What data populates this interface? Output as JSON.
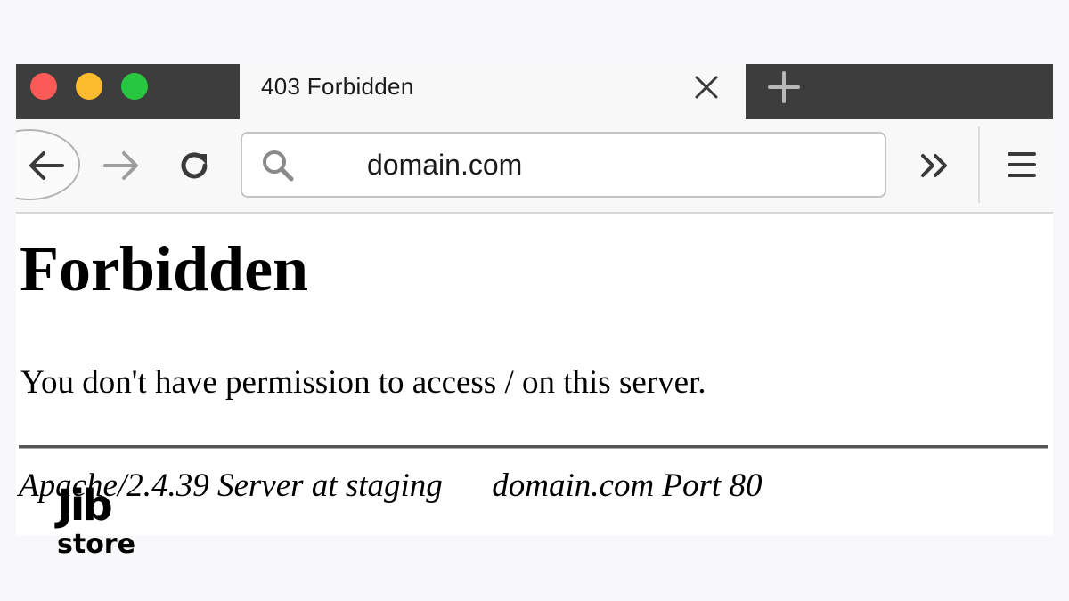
{
  "browser": {
    "tab": {
      "title": "403 Forbidden"
    },
    "address_bar": {
      "url": "domain.com"
    },
    "icons": [
      "back-arrow-icon",
      "forward-arrow-icon",
      "reload-icon",
      "search-icon",
      "close-icon",
      "plus-icon",
      "chevron-double-right-icon",
      "hamburger-menu-icon"
    ]
  },
  "page": {
    "heading": "Forbidden",
    "message": "You don't have permission to access / on this server.",
    "address": "Apache/2.4.39 Server at staging      domain.com Port 80"
  },
  "watermark": {
    "mark": "Jib",
    "sub": "store"
  },
  "colors": {
    "window_close": "#fc5a56",
    "window_minimize": "#fdbc2e",
    "window_maximize": "#27c840",
    "tabstrip": "#3d3d3d"
  }
}
